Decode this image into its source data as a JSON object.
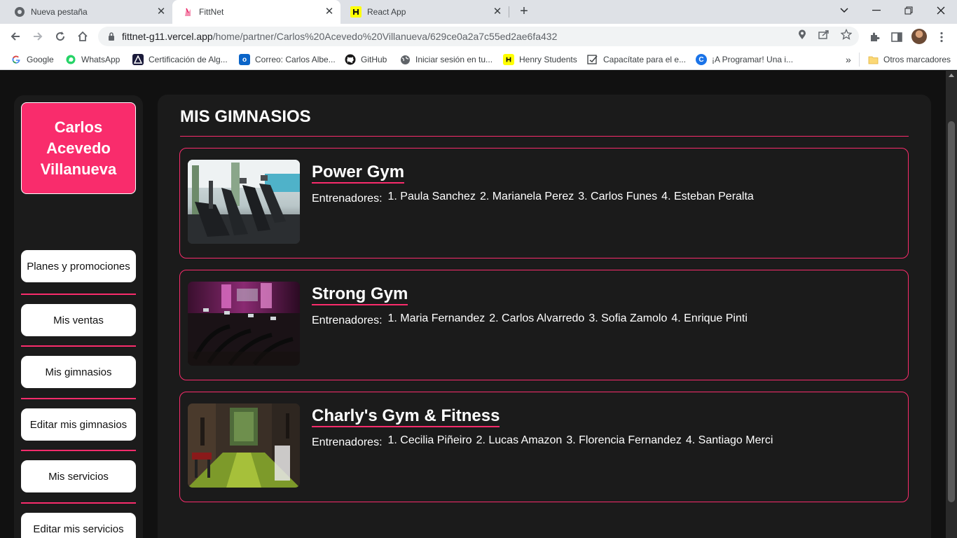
{
  "browser": {
    "tabs": [
      {
        "title": "Nueva pestaña",
        "icon": "chrome-icon",
        "active": false
      },
      {
        "title": "FittNet",
        "icon": "fittnet-icon",
        "active": true
      },
      {
        "title": "React App",
        "icon": "henry-icon",
        "active": false
      }
    ],
    "url_host": "fittnet-g11.vercel.app",
    "url_path": "/home/partner/Carlos%20Acevedo%20Villanueva/629ce0a2a7c55ed2ae6fa432",
    "bookmarks": [
      {
        "label": "Google"
      },
      {
        "label": "WhatsApp"
      },
      {
        "label": "Certificación de Alg..."
      },
      {
        "label": "Correo: Carlos Albe..."
      },
      {
        "label": "GitHub"
      },
      {
        "label": "Iniciar sesión en tu..."
      },
      {
        "label": "Henry Students"
      },
      {
        "label": "Capacítate para el e..."
      },
      {
        "label": "¡A Programar! Una i..."
      }
    ],
    "overflow_label": "»",
    "other_bookmarks": "Otros marcadores"
  },
  "sidebar": {
    "user_name": "Carlos Acevedo Villanueva",
    "menu": [
      {
        "label": "Planes y promociones"
      },
      {
        "label": "Mis ventas"
      },
      {
        "label": "Mis gimnasios"
      },
      {
        "label": "Editar mis gimnasios"
      },
      {
        "label": "Mis servicios"
      },
      {
        "label": "Editar mis servicios"
      }
    ]
  },
  "main": {
    "title": "MIS GIMNASIOS",
    "trainers_label": "Entrenadores:",
    "gyms": [
      {
        "name": "Power Gym",
        "trainers": [
          "1. Paula Sanchez",
          "2. Marianela Perez",
          "3. Carlos Funes",
          "4. Esteban Peralta"
        ]
      },
      {
        "name": "Strong Gym",
        "trainers": [
          "1. Maria Fernandez",
          "2. Carlos Alvarredo",
          "3. Sofia Zamolo",
          "4. Enrique Pinti"
        ]
      },
      {
        "name": "Charly's Gym & Fitness",
        "trainers": [
          "1. Cecilia Piñeiro",
          "2. Lucas Amazon",
          "3. Florencia Fernandez",
          "4. Santiago Merci"
        ]
      }
    ]
  },
  "colors": {
    "accent": "#f92c6c",
    "page_bg": "#111111",
    "panel_bg": "#1b1b1b"
  }
}
